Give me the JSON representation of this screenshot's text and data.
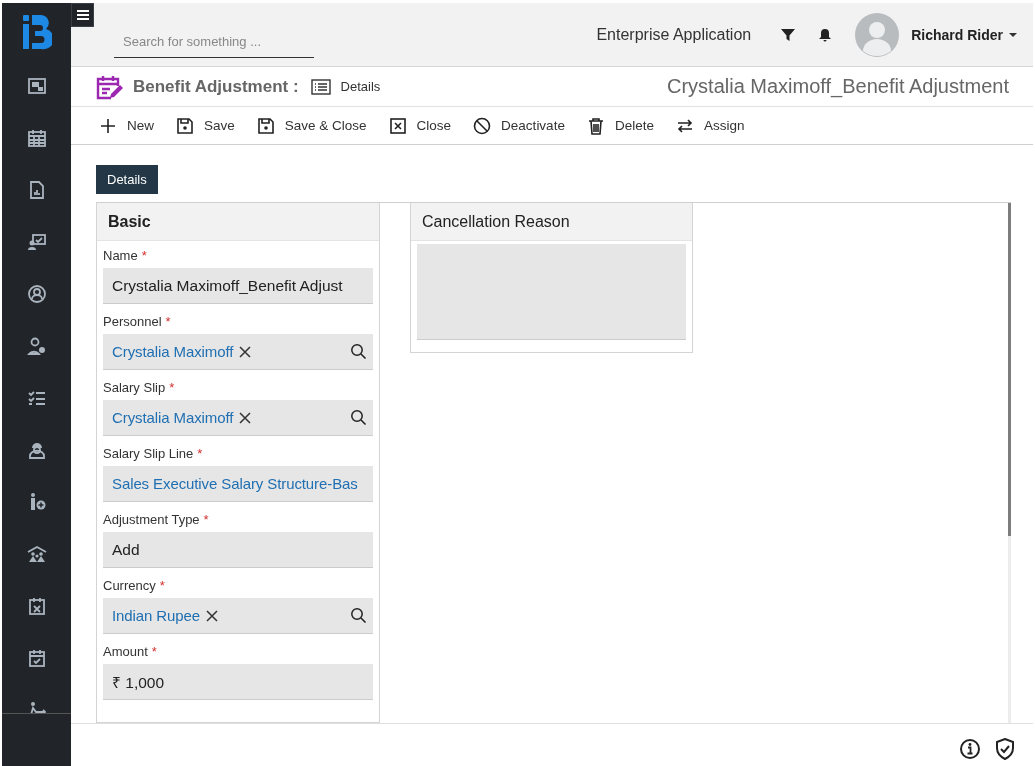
{
  "header": {
    "search": {
      "placeholder": "Search for something ..."
    },
    "app_name": "Enterprise Application",
    "user": {
      "name": "Richard Rider"
    }
  },
  "title_bar": {
    "module": "Benefit Adjustment :",
    "view": "Details",
    "record": "Crystalia Maximoff_Benefit Adjustment"
  },
  "toolbar": [
    {
      "kind": "new",
      "label": "New"
    },
    {
      "kind": "save",
      "label": "Save"
    },
    {
      "kind": "save_close",
      "label": "Save & Close"
    },
    {
      "kind": "close",
      "label": "Close"
    },
    {
      "kind": "deactivate",
      "label": "Deactivate"
    },
    {
      "kind": "delete",
      "label": "Delete"
    },
    {
      "kind": "assign",
      "label": "Assign"
    }
  ],
  "tabs": [
    {
      "label": "Details",
      "selected": true
    }
  ],
  "sections": [
    {
      "title": "Basic",
      "kind": "form",
      "fields": [
        {
          "label": "Name",
          "required_mark": "*",
          "kind": "text",
          "value": "Crystalia Maximoff_Benefit Adjust"
        },
        {
          "label": "Personnel",
          "required_mark": "*",
          "kind": "lookup",
          "value": "Crystalia Maximoff",
          "clearable": true
        },
        {
          "label": "Salary Slip",
          "required_mark": "*",
          "kind": "lookup",
          "value": "Crystalia Maximoff",
          "clearable": true
        },
        {
          "label": "Salary Slip Line",
          "required_mark": "*",
          "kind": "lookup",
          "value": "Sales Executive Salary Structure-Bas",
          "clearable": false
        },
        {
          "label": "Adjustment Type",
          "required_mark": "*",
          "kind": "text",
          "value": "Add"
        },
        {
          "label": "Currency",
          "required_mark": "*",
          "kind": "lookup",
          "value": "Indian Rupee",
          "clearable": true
        },
        {
          "label": "Amount",
          "required_mark": "*",
          "kind": "text",
          "value": "₹ 1,000"
        }
      ]
    },
    {
      "title": "Cancellation Reason",
      "kind": "memo"
    }
  ]
}
